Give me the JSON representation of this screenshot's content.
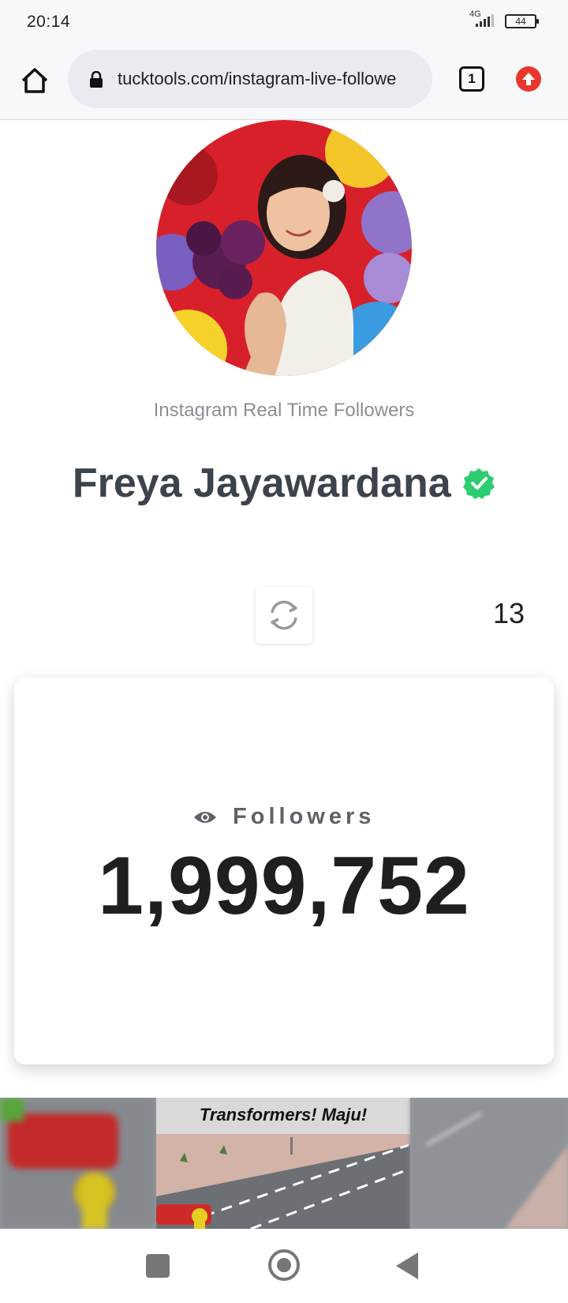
{
  "status_bar": {
    "time": "20:14",
    "network": "4G",
    "battery": "44"
  },
  "browser": {
    "url": "tucktools.com/instagram-live-followe",
    "tab_count": "1"
  },
  "profile": {
    "subtitle": "Instagram Real Time Followers",
    "name": "Freya Jayawardana",
    "verified": true
  },
  "refresh": {
    "countdown": "13"
  },
  "followers_card": {
    "label": "Followers",
    "count": "1,999,752"
  },
  "ad": {
    "title": "Transformers! Maju!"
  },
  "colors": {
    "verified_badge": "#2ecc71",
    "update_button": "#e8382d",
    "name_text": "#3d434c"
  }
}
